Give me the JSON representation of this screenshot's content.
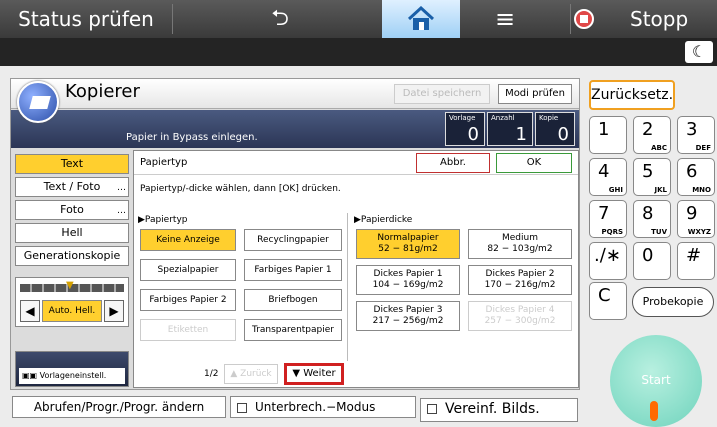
{
  "topbar": {
    "status": "Status prüfen",
    "back_glyph": "⮌",
    "menu_glyph": "≡",
    "stop": "Stopp"
  },
  "app": {
    "title": "Kopierer",
    "save_file": "Datei speichern",
    "check_modes": "Modi prüfen",
    "message": "Papier in Bypass einlegen.",
    "counters": [
      {
        "label": "Vorlage",
        "value": "0"
      },
      {
        "label": "Anzahl",
        "value": "1"
      },
      {
        "label": "Kopie",
        "value": "0"
      }
    ]
  },
  "left": {
    "modes": [
      {
        "label": "Text",
        "selected": true
      },
      {
        "label": "Text / Foto"
      },
      {
        "label": "Foto"
      },
      {
        "label": "Hell"
      },
      {
        "label": "Generationskopie"
      }
    ],
    "density": "Auto. Hell.",
    "preset": "Vorlageneinstell."
  },
  "dialog": {
    "title": "Papiertyp",
    "cancel": "Abbr.",
    "ok": "OK",
    "hint": "Papiertyp/-dicke wählen, dann [OK] drücken.",
    "type_header": "▶Papiertyp",
    "types": [
      "Keine Anzeige",
      "Recyclingpapier",
      "Spezialpapier",
      "Farbiges Papier 1",
      "Farbiges Papier 2",
      "Briefbogen",
      "Etiketten",
      "Transparentpapier"
    ],
    "thickness_header": "▶Papierdicke",
    "thicknesses": [
      {
        "name": "Normalpapier",
        "range": "52 − 81g/m2"
      },
      {
        "name": "Medium",
        "range": "82 − 103g/m2"
      },
      {
        "name": "Dickes Papier 1",
        "range": "104 − 169g/m2"
      },
      {
        "name": "Dickes Papier 2",
        "range": "170 − 216g/m2"
      },
      {
        "name": "Dickes Papier 3",
        "range": "217 − 256g/m2"
      },
      {
        "name": "Dickes Papier 4",
        "range": "257 − 300g/m2"
      }
    ],
    "page": "1/2",
    "back": "Zurück",
    "next": "Weiter"
  },
  "bottom": {
    "recall": "Abrufen/Progr./Progr. ändern",
    "interrupt": "Unterbrech.−Modus",
    "simple": "Vereinf. Bilds."
  },
  "keypad": {
    "reset": "Zurücksetz.",
    "keys": [
      {
        "n": "1",
        "s": ""
      },
      {
        "n": "2",
        "s": "ABC"
      },
      {
        "n": "3",
        "s": "DEF"
      },
      {
        "n": "4",
        "s": "GHI"
      },
      {
        "n": "5",
        "s": "JKL"
      },
      {
        "n": "6",
        "s": "MNO"
      },
      {
        "n": "7",
        "s": "PQRS"
      },
      {
        "n": "8",
        "s": "TUV"
      },
      {
        "n": "9",
        "s": "WXYZ"
      },
      {
        "n": ".∕∗",
        "s": ""
      },
      {
        "n": "0",
        "s": ""
      },
      {
        "n": "#",
        "s": ""
      }
    ],
    "clear": "C",
    "sample": "Probekopie",
    "start": "Start"
  }
}
